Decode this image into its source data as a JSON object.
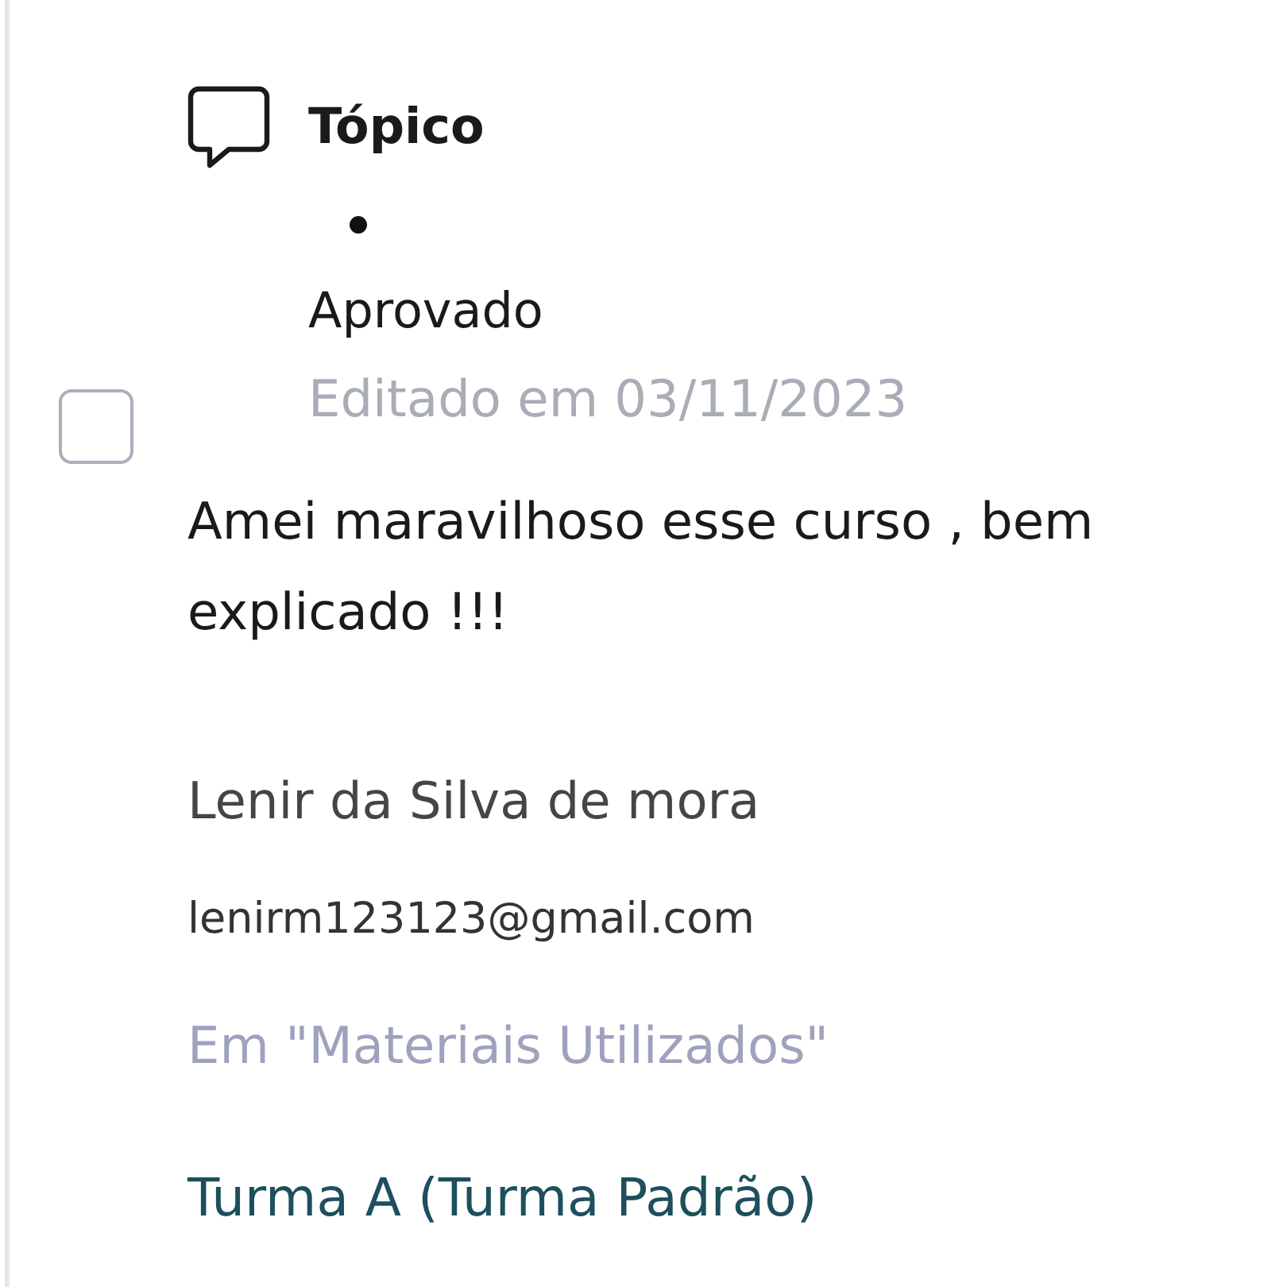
{
  "post": {
    "type_label": "Tópico",
    "status": "Aprovado",
    "edited": "Editado em 03/11/2023",
    "select_checkbox": {
      "checked": false
    }
  },
  "comment": "Amei maravilhoso esse curso , bem explicado !!!",
  "author": {
    "name": "Lenir da Silva de mora",
    "email": "lenirm123123@gmail.com"
  },
  "location": "Em \"Materiais Utilizados\"",
  "class_link": "Turma A (Turma Padrão)"
}
